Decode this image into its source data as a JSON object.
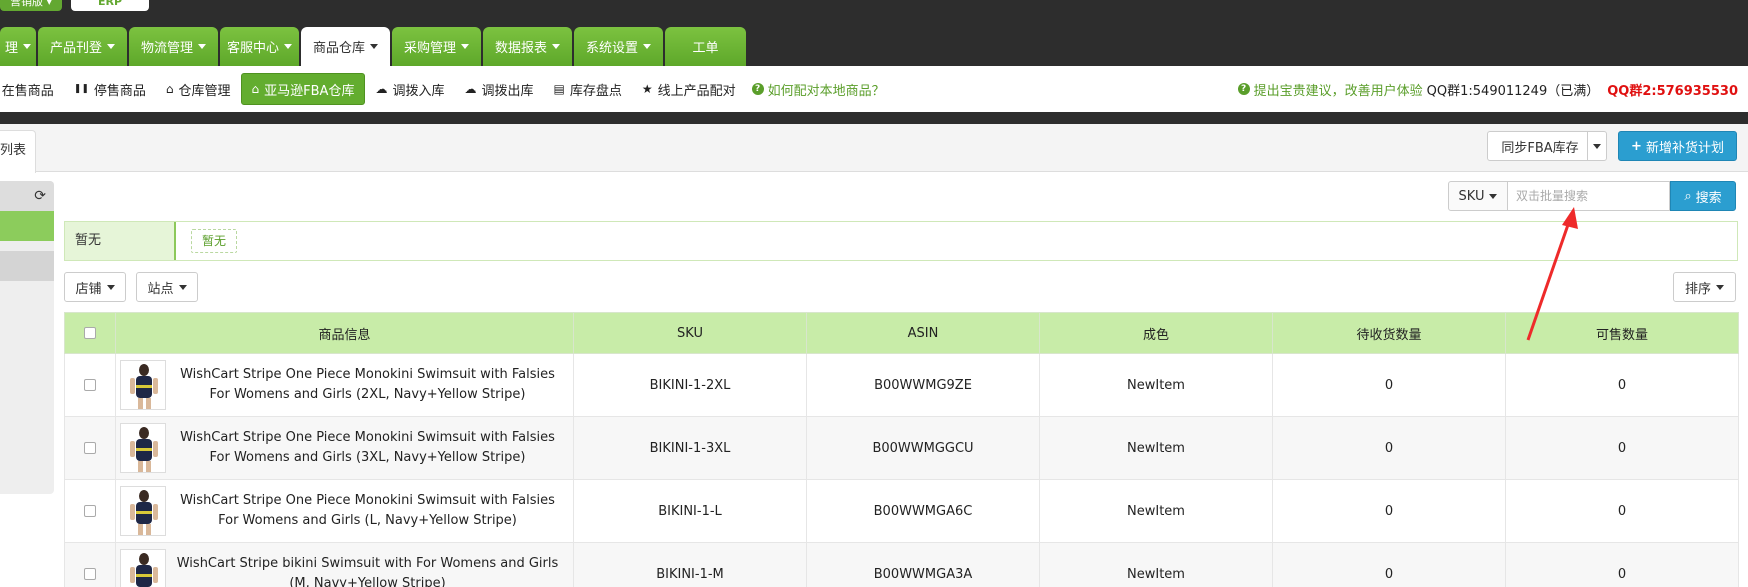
{
  "topbar": {
    "mini_left": "营销版 ▾",
    "mini_right": "ERP"
  },
  "main_tabs": [
    {
      "label": "理",
      "has_caret": true,
      "active": false
    },
    {
      "label": "产品刊登",
      "has_caret": true,
      "active": false
    },
    {
      "label": "物流管理",
      "has_caret": true,
      "active": false
    },
    {
      "label": "客服中心",
      "has_caret": true,
      "active": false
    },
    {
      "label": "商品仓库",
      "has_caret": true,
      "active": true
    },
    {
      "label": "采购管理",
      "has_caret": true,
      "active": false
    },
    {
      "label": "数据报表",
      "has_caret": true,
      "active": false
    },
    {
      "label": "系统设置",
      "has_caret": true,
      "active": false
    },
    {
      "label": "工单",
      "has_caret": false,
      "active": false
    }
  ],
  "sub_nav": {
    "items": [
      {
        "label": "在售商品",
        "icon": "list-icon",
        "glyph": "☰",
        "active": false
      },
      {
        "label": "停售商品",
        "icon": "pause-icon",
        "glyph": "❚❚",
        "active": false
      },
      {
        "label": "仓库管理",
        "icon": "home-icon",
        "glyph": "⌂",
        "active": false
      },
      {
        "label": "亚马逊FBA仓库",
        "icon": "home-icon",
        "glyph": "⌂",
        "active": true
      },
      {
        "label": "调拨入库",
        "icon": "cloud-upload-icon",
        "glyph": "☁",
        "active": false
      },
      {
        "label": "调拨出库",
        "icon": "cloud-download-icon",
        "glyph": "☁",
        "active": false
      },
      {
        "label": "库存盘点",
        "icon": "barcode-icon",
        "glyph": "▤",
        "active": false
      },
      {
        "label": "线上产品配对",
        "icon": "star-icon",
        "glyph": "★",
        "active": false
      }
    ],
    "help_link": "如何配对本地商品？",
    "suggest_link": "提出宝贵建议，改善用户体验",
    "qq1": "QQ群1:549011249（已满）",
    "qq2": "QQ群2:576935530"
  },
  "toolbar": {
    "list_tab": "列表",
    "sync_button": "同步FBA库存",
    "new_plan_button": "新增补货计划"
  },
  "search": {
    "field": "SKU",
    "placeholder": "双击批量搜索",
    "button": "搜索"
  },
  "filter": {
    "label": "暂无",
    "tag": "暂无"
  },
  "filters": {
    "store": "店铺",
    "site": "站点",
    "sort": "排序"
  },
  "table": {
    "headers": [
      "商品信息",
      "SKU",
      "ASIN",
      "成色",
      "待收货数量",
      "可售数量"
    ],
    "rows": [
      {
        "name": "WishCart Stripe One Piece Monokini Swimsuit with Falsies For Womens and Girls (2XL, Navy+Yellow Stripe)",
        "sku": "BIKINI-1-2XL",
        "asin": "B00WWMG9ZE",
        "condition": "NewItem",
        "pending": "0",
        "available": "0"
      },
      {
        "name": "WishCart Stripe One Piece Monokini Swimsuit with Falsies For Womens and Girls (3XL, Navy+Yellow Stripe)",
        "sku": "BIKINI-1-3XL",
        "asin": "B00WWMGGCU",
        "condition": "NewItem",
        "pending": "0",
        "available": "0"
      },
      {
        "name": "WishCart Stripe One Piece Monokini Swimsuit with Falsies For Womens and Girls (L, Navy+Yellow Stripe)",
        "sku": "BIKINI-1-L",
        "asin": "B00WWMGA6C",
        "condition": "NewItem",
        "pending": "0",
        "available": "0"
      },
      {
        "name": "WishCart Stripe bikini Swimsuit with For Womens and Girls (M, Navy+Yellow Stripe)",
        "sku": "BIKINI-1-M",
        "asin": "B00WWMGA3A",
        "condition": "NewItem",
        "pending": "0",
        "available": "0"
      }
    ]
  },
  "colors": {
    "tab_green": "#63a831",
    "header_green": "#c8eca8",
    "primary_blue": "#2b9ed0",
    "qq2_red": "#e01010",
    "arrow_red": "#ee2a2a"
  }
}
